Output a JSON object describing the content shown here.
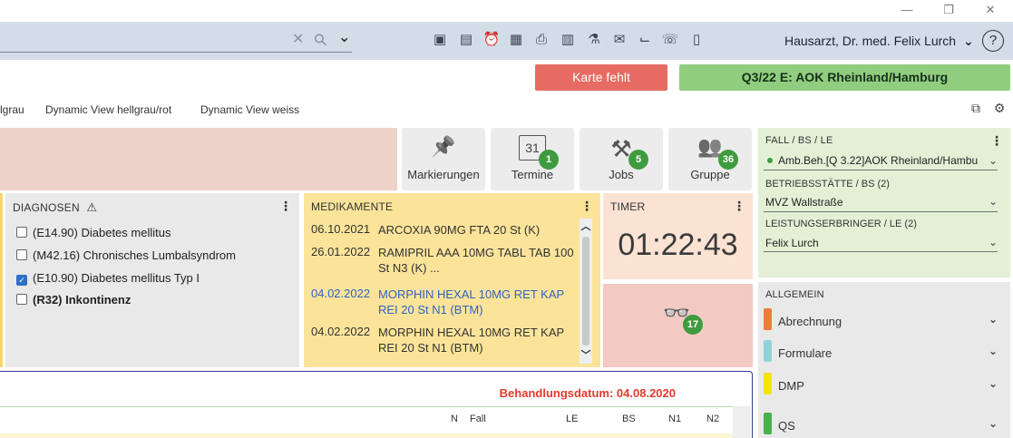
{
  "window": {
    "minimize": "—",
    "restore": "❐",
    "close": "✕"
  },
  "search": {
    "clear_icon": "✕",
    "search_icon": "⚲",
    "dropdown_icon": "⌄"
  },
  "toolbar": {
    "icons": [
      "▣",
      "▤",
      "⏰",
      "▦",
      "⎙",
      "▥",
      "⚗",
      "✉",
      "⌙",
      "☏",
      "▯"
    ]
  },
  "user": {
    "name": "Hausarzt, Dr. med. Felix Lurch",
    "chevron": "⌄",
    "help": "?"
  },
  "alerts": {
    "karte": "Karte fehlt",
    "quartal": "Q3/22 E: AOK Rheinland/Hamburg"
  },
  "views": [
    "lgrau",
    "Dynamic View hellgrau/rot",
    "Dynamic View weiss"
  ],
  "view_icons": [
    "⧉",
    "⚙"
  ],
  "tiles": [
    {
      "label": "Markierungen",
      "icon": "📌",
      "badge": ""
    },
    {
      "label": "Termine",
      "icon": "31",
      "badge": "1"
    },
    {
      "label": "Jobs",
      "icon": "⚒",
      "badge": "5"
    },
    {
      "label": "Gruppe",
      "icon": "👥",
      "badge": "36"
    }
  ],
  "fall": {
    "title": "FALL / BS / LE",
    "fall_value": "Amb.Beh.[Q 3.22]AOK Rheinland/Hambu",
    "bs_label": "BETRIEBSSTÄTTE / BS (2)",
    "bs_value": "MVZ Wallstraße",
    "le_label": "LEISTUNGSERBRINGER / LE (2)",
    "le_value": "Felix Lurch"
  },
  "diagnosen": {
    "title": "DIAGNOSEN",
    "warn_icon": "⚠",
    "items": [
      {
        "text": "(E14.90) Diabetes mellitus",
        "checked": false,
        "bold": false
      },
      {
        "text": "(M42.16) Chronisches Lumbalsyndrom",
        "checked": false,
        "bold": false
      },
      {
        "text": "(E10.90) Diabetes mellitus Typ I",
        "checked": true,
        "bold": false
      },
      {
        "text": "(R32) Inkontinenz",
        "checked": false,
        "bold": true
      }
    ]
  },
  "medikamente": {
    "title": "MEDIKAMENTE",
    "items": [
      {
        "date": "06.10.2021",
        "name": "ARCOXIA 90MG FTA 20 St (K)",
        "blue": false
      },
      {
        "date": "26.01.2022",
        "name": "RAMIPRIL AAA 10MG TABL TAB 100 St N3 (K) ...",
        "blue": false
      },
      {
        "date": "04.02.2022",
        "name": "MORPHIN HEXAL 10MG RET KAP REI 20 St N1 (BTM)",
        "blue": true
      },
      {
        "date": "04.02.2022",
        "name": "MORPHIN HEXAL 10MG RET KAP REI 20 St N1 (BTM)",
        "blue": false
      }
    ]
  },
  "timer": {
    "title": "TIMER",
    "value": "01:22:43"
  },
  "binoculars": {
    "icon": "👓",
    "badge": "17"
  },
  "allgemein": {
    "title": "ALLGEMEIN",
    "items": [
      {
        "label": "Abrechnung",
        "color": "#f07a3a"
      },
      {
        "label": "Formulare",
        "color": "#8fd3d8"
      },
      {
        "label": "DMP",
        "color": "#f2e600"
      },
      {
        "label": "QS",
        "color": "#49b04a"
      }
    ]
  },
  "behandlung": {
    "datum": "Behandlungsdatum: 04.08.2020",
    "columns": [
      "N",
      "Fall",
      "LE",
      "BS",
      "N1",
      "N2"
    ]
  },
  "colors": {
    "topbar": "#d3dde7",
    "karte": "#e76b63",
    "quartal": "#91cd7f",
    "diagnosen_bg": "#e9e9e9",
    "medikamente_bg": "#fbe49a",
    "timer_bg": "#fbe3d3",
    "fall_bg": "#e3f0d6",
    "red_text": "#e23b2e"
  }
}
